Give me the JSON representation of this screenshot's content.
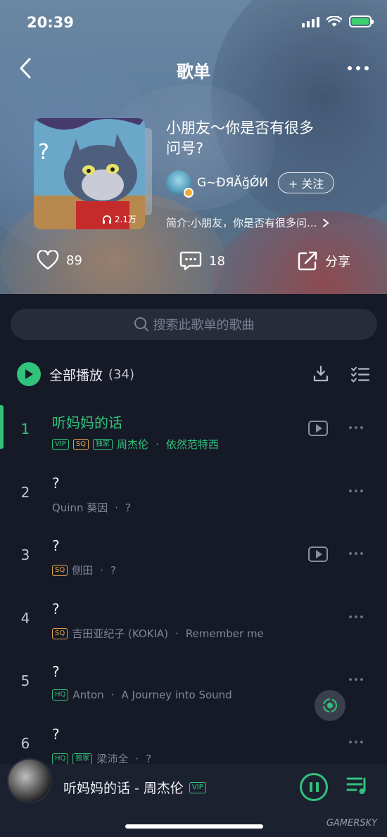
{
  "status": {
    "time": "20:39"
  },
  "nav": {
    "title": "歌单"
  },
  "playlist": {
    "title": "小朋友～你是否有很多问号?",
    "listen_count": "2.1万",
    "creator": "G~ĐЯĂğǾИ",
    "follow_label": "+ 关注",
    "intro": "简介:小朋友，你是否有很多问...",
    "likes": "89",
    "comments": "18",
    "share_label": "分享"
  },
  "search": {
    "placeholder": "搜索此歌单的歌曲"
  },
  "playall": {
    "label": "全部播放",
    "count": "(34)"
  },
  "tags": {
    "vip": "VIP",
    "sq": "SQ",
    "hq": "HQ",
    "exclusive": "独家"
  },
  "songs": [
    {
      "index": "1",
      "title": "听妈妈的话",
      "artist": "周杰伦",
      "album": "依然范特西"
    },
    {
      "index": "2",
      "title": "?",
      "artist": "Quinn 葵因",
      "album": "?"
    },
    {
      "index": "3",
      "title": "?",
      "artist": "侧田",
      "album": "?"
    },
    {
      "index": "4",
      "title": "?",
      "artist": "吉田亚纪子 (KOKIA)",
      "album": "Remember me"
    },
    {
      "index": "5",
      "title": "?",
      "artist": "Anton",
      "album": "A Journey into Sound"
    },
    {
      "index": "6",
      "title": "?",
      "artist": "梁沛全",
      "album": "?"
    }
  ],
  "player": {
    "now_playing": "听妈妈的话 - 周杰伦"
  },
  "watermark": "GAMERSKY",
  "colors": {
    "accent": "#31c27c",
    "background": "#161a26",
    "sq": "#e1a24b"
  }
}
